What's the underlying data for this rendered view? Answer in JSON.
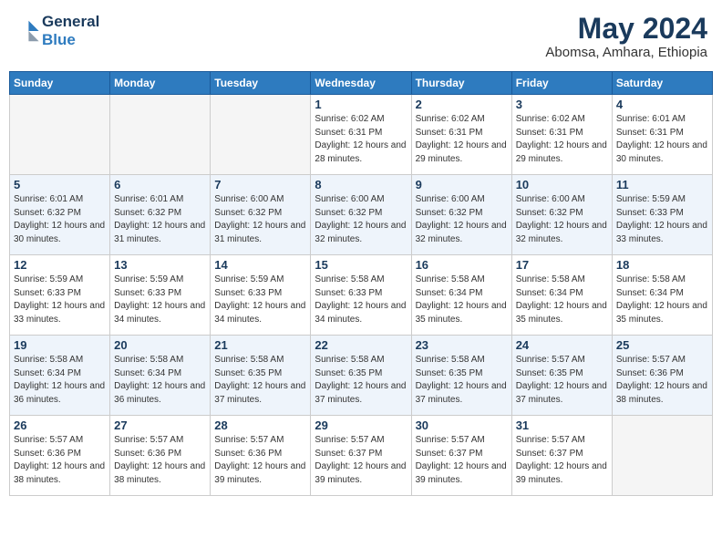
{
  "header": {
    "logo_line1": "General",
    "logo_line2": "Blue",
    "month_year": "May 2024",
    "location": "Abomsa, Amhara, Ethiopia"
  },
  "days_of_week": [
    "Sunday",
    "Monday",
    "Tuesday",
    "Wednesday",
    "Thursday",
    "Friday",
    "Saturday"
  ],
  "weeks": [
    {
      "shaded": false,
      "days": [
        {
          "num": "",
          "detail": ""
        },
        {
          "num": "",
          "detail": ""
        },
        {
          "num": "",
          "detail": ""
        },
        {
          "num": "1",
          "detail": "Sunrise: 6:02 AM\nSunset: 6:31 PM\nDaylight: 12 hours\nand 28 minutes."
        },
        {
          "num": "2",
          "detail": "Sunrise: 6:02 AM\nSunset: 6:31 PM\nDaylight: 12 hours\nand 29 minutes."
        },
        {
          "num": "3",
          "detail": "Sunrise: 6:02 AM\nSunset: 6:31 PM\nDaylight: 12 hours\nand 29 minutes."
        },
        {
          "num": "4",
          "detail": "Sunrise: 6:01 AM\nSunset: 6:31 PM\nDaylight: 12 hours\nand 30 minutes."
        }
      ]
    },
    {
      "shaded": true,
      "days": [
        {
          "num": "5",
          "detail": "Sunrise: 6:01 AM\nSunset: 6:32 PM\nDaylight: 12 hours\nand 30 minutes."
        },
        {
          "num": "6",
          "detail": "Sunrise: 6:01 AM\nSunset: 6:32 PM\nDaylight: 12 hours\nand 31 minutes."
        },
        {
          "num": "7",
          "detail": "Sunrise: 6:00 AM\nSunset: 6:32 PM\nDaylight: 12 hours\nand 31 minutes."
        },
        {
          "num": "8",
          "detail": "Sunrise: 6:00 AM\nSunset: 6:32 PM\nDaylight: 12 hours\nand 32 minutes."
        },
        {
          "num": "9",
          "detail": "Sunrise: 6:00 AM\nSunset: 6:32 PM\nDaylight: 12 hours\nand 32 minutes."
        },
        {
          "num": "10",
          "detail": "Sunrise: 6:00 AM\nSunset: 6:32 PM\nDaylight: 12 hours\nand 32 minutes."
        },
        {
          "num": "11",
          "detail": "Sunrise: 5:59 AM\nSunset: 6:33 PM\nDaylight: 12 hours\nand 33 minutes."
        }
      ]
    },
    {
      "shaded": false,
      "days": [
        {
          "num": "12",
          "detail": "Sunrise: 5:59 AM\nSunset: 6:33 PM\nDaylight: 12 hours\nand 33 minutes."
        },
        {
          "num": "13",
          "detail": "Sunrise: 5:59 AM\nSunset: 6:33 PM\nDaylight: 12 hours\nand 34 minutes."
        },
        {
          "num": "14",
          "detail": "Sunrise: 5:59 AM\nSunset: 6:33 PM\nDaylight: 12 hours\nand 34 minutes."
        },
        {
          "num": "15",
          "detail": "Sunrise: 5:58 AM\nSunset: 6:33 PM\nDaylight: 12 hours\nand 34 minutes."
        },
        {
          "num": "16",
          "detail": "Sunrise: 5:58 AM\nSunset: 6:34 PM\nDaylight: 12 hours\nand 35 minutes."
        },
        {
          "num": "17",
          "detail": "Sunrise: 5:58 AM\nSunset: 6:34 PM\nDaylight: 12 hours\nand 35 minutes."
        },
        {
          "num": "18",
          "detail": "Sunrise: 5:58 AM\nSunset: 6:34 PM\nDaylight: 12 hours\nand 35 minutes."
        }
      ]
    },
    {
      "shaded": true,
      "days": [
        {
          "num": "19",
          "detail": "Sunrise: 5:58 AM\nSunset: 6:34 PM\nDaylight: 12 hours\nand 36 minutes."
        },
        {
          "num": "20",
          "detail": "Sunrise: 5:58 AM\nSunset: 6:34 PM\nDaylight: 12 hours\nand 36 minutes."
        },
        {
          "num": "21",
          "detail": "Sunrise: 5:58 AM\nSunset: 6:35 PM\nDaylight: 12 hours\nand 37 minutes."
        },
        {
          "num": "22",
          "detail": "Sunrise: 5:58 AM\nSunset: 6:35 PM\nDaylight: 12 hours\nand 37 minutes."
        },
        {
          "num": "23",
          "detail": "Sunrise: 5:58 AM\nSunset: 6:35 PM\nDaylight: 12 hours\nand 37 minutes."
        },
        {
          "num": "24",
          "detail": "Sunrise: 5:57 AM\nSunset: 6:35 PM\nDaylight: 12 hours\nand 37 minutes."
        },
        {
          "num": "25",
          "detail": "Sunrise: 5:57 AM\nSunset: 6:36 PM\nDaylight: 12 hours\nand 38 minutes."
        }
      ]
    },
    {
      "shaded": false,
      "days": [
        {
          "num": "26",
          "detail": "Sunrise: 5:57 AM\nSunset: 6:36 PM\nDaylight: 12 hours\nand 38 minutes."
        },
        {
          "num": "27",
          "detail": "Sunrise: 5:57 AM\nSunset: 6:36 PM\nDaylight: 12 hours\nand 38 minutes."
        },
        {
          "num": "28",
          "detail": "Sunrise: 5:57 AM\nSunset: 6:36 PM\nDaylight: 12 hours\nand 39 minutes."
        },
        {
          "num": "29",
          "detail": "Sunrise: 5:57 AM\nSunset: 6:37 PM\nDaylight: 12 hours\nand 39 minutes."
        },
        {
          "num": "30",
          "detail": "Sunrise: 5:57 AM\nSunset: 6:37 PM\nDaylight: 12 hours\nand 39 minutes."
        },
        {
          "num": "31",
          "detail": "Sunrise: 5:57 AM\nSunset: 6:37 PM\nDaylight: 12 hours\nand 39 minutes."
        },
        {
          "num": "",
          "detail": ""
        }
      ]
    }
  ]
}
